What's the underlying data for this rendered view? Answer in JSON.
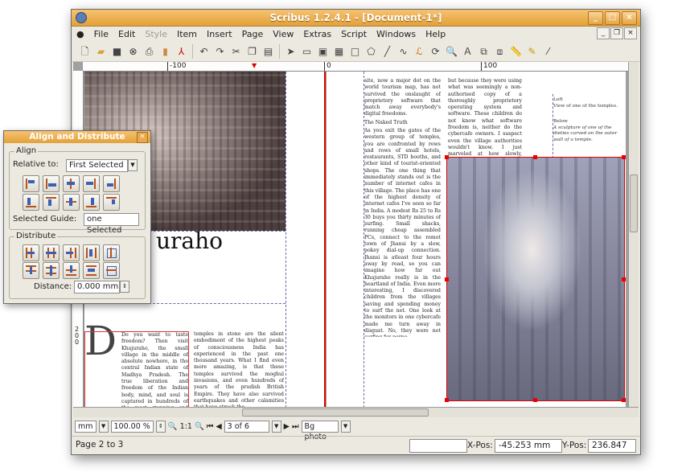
{
  "window": {
    "title": "Scribus 1.2.4.1 - [Document-1*]",
    "buttons": {
      "minimize": "_",
      "maximize": "□",
      "close": "×"
    }
  },
  "menu": [
    {
      "label": "File",
      "enabled": true
    },
    {
      "label": "Edit",
      "enabled": true
    },
    {
      "label": "Style",
      "enabled": false
    },
    {
      "label": "Item",
      "enabled": true
    },
    {
      "label": "Insert",
      "enabled": true
    },
    {
      "label": "Page",
      "enabled": true
    },
    {
      "label": "View",
      "enabled": true
    },
    {
      "label": "Extras",
      "enabled": true
    },
    {
      "label": "Script",
      "enabled": true
    },
    {
      "label": "Windows",
      "enabled": true
    },
    {
      "label": "Help",
      "enabled": true
    }
  ],
  "toolbar_icons": [
    "new-document-icon",
    "open-folder-icon",
    "save-icon",
    "close-document-icon",
    "print-icon",
    "preflight-icon",
    "export-pdf-icon",
    "undo-icon",
    "redo-icon",
    "cut-icon",
    "copy-icon",
    "paste-icon",
    "select-icon",
    "text-frame-icon",
    "image-frame-icon",
    "table-icon",
    "shape-icon",
    "polygon-icon",
    "line-icon",
    "bezier-icon",
    "freehand-icon",
    "rotate-icon",
    "zoom-icon",
    "edit-text-icon",
    "link-frames-icon",
    "unlink-frames-icon",
    "measure-icon",
    "copy-properties-icon",
    "eyedropper-icon"
  ],
  "ruler": {
    "marks": [
      "-100",
      "0",
      "100"
    ]
  },
  "document": {
    "heading_fragment": "uraho",
    "dropcap": "D",
    "col1": "Do you want to taste freedom? Then visit Khajuraho, the small village in the middle of absolute nowhere, in the central Indian state of Madhya Pradesh. The true liberation and freedom of the Indian body, mind, and soul is captured in hundreds of the most stunning and erotic sculptures in exquisite details. The",
    "col2": "temples in stone are the silent embodiment of the highest peaks of consciousness India has experienced in the past one thousand years. What I find even more amazing, is that these temples survived the moghul invasions, and even hundreds of years of the prudish British Empire. They have also survived earthquakes and other calamities that have struck the",
    "col3_top": "site, now a major dot on the world tourism map, has not survived the onslaught of proprietory software that match away everybody's digital freedoms.",
    "col3_heading": "The Naked Truth",
    "col3_body": "As you exit the gates of the western group of temples, you are confronted by rows and rows of small hotels, restaurants, STD booths, and other kind of tourist-oriented shops. The one thing that immediately stands out is the number of internet cafes in this village. The place has one of the highest density of internet cafes I've seen so far in India. A modest Rs 25 to Rs 30 buys you thirty minutes of surfing. Small shacks, running cheap assembled PCs, connect to the remot town of Jhansi by a slow, pokey dial-up connection. Jhansi is atleast four hours away by road, so you can imagine how far out Khajuraho really is in the heartland of India. Even more interesting, I discovered children from the villages saving and spending money to surf the net. One look at the monitors in one cybercafe made me turn away in disgust. No, they were not surfing for porno-",
    "col4_top": "but because they were using what was seemingly a non-authorised copy of a thoroughly proprietory operating system and software. These children do not know what software freedom is, neither do the cybercafe owners. I suspect even the village authorities wouldn't know. I just marveled at how slowly, unwittingly, a whole village will grow up and acquire skills on proprietory software, and find one",
    "caption": {
      "l1": "Left",
      "l2": "View of one of the temples.",
      "l3": "Below",
      "l4": "A sculpture of one of the dieties carved on the outer wall of a temple."
    },
    "vruler_marks": [
      "2",
      "0",
      "0"
    ]
  },
  "align_dialog": {
    "title": "Align and Distribute",
    "align_group": "Align",
    "relative_to_label": "Relative to:",
    "relative_to_value": "First Selected",
    "selected_guide_label": "Selected Guide:",
    "selected_guide_value": "one Selected",
    "distribute_group": "Distribute",
    "distance_label": "Distance:",
    "distance_value": "0.000 mm"
  },
  "bottombar": {
    "unit": "mm",
    "zoom": "100.00 %",
    "one_to_one": "1:1",
    "page": "3 of 6",
    "layer": "Bg photo"
  },
  "status": {
    "page_label": "Page 2 to 3",
    "xpos_label": "X-Pos:",
    "xpos_value": "-45.253 mm",
    "ypos_label": "Y-Pos:",
    "ypos_value": "236.847 mm"
  },
  "colors": {
    "accent": "#e2a13a",
    "guide": "#dd0000",
    "background": "#ece9e0"
  }
}
